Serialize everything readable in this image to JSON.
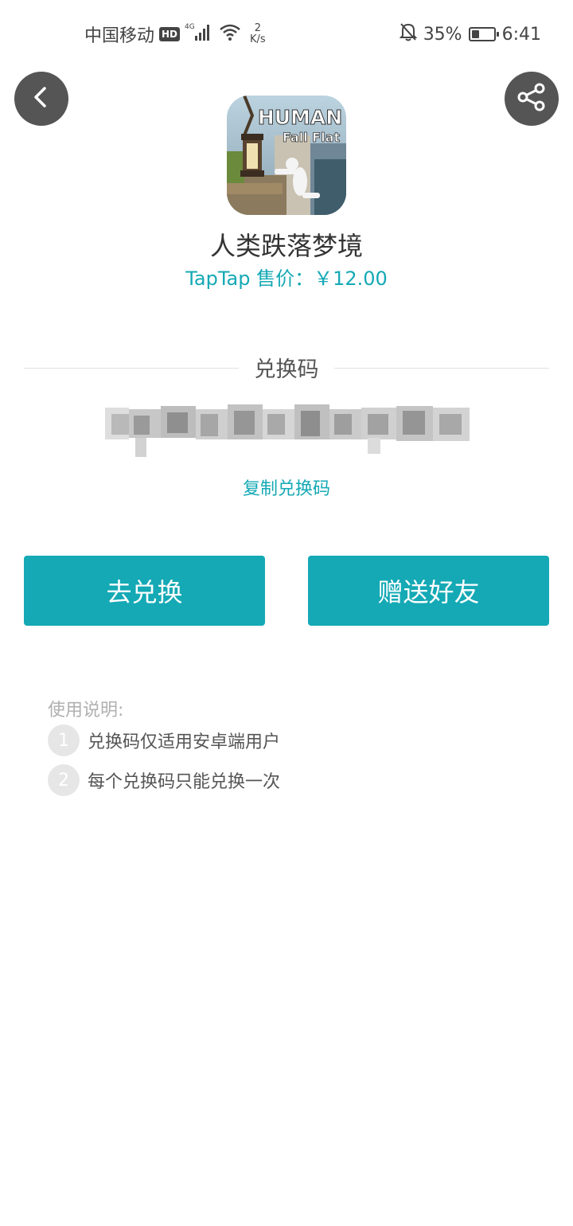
{
  "status_bar": {
    "carrier": "中国移动",
    "hd_badge": "HD",
    "network_type": "4G",
    "net_speed_value": "2",
    "net_speed_unit": "K/s",
    "battery_percent": "35%",
    "battery_level": 0.35,
    "time": "6:41"
  },
  "app": {
    "name": "人类跌落梦境",
    "price": "TapTap 售价：￥12.00",
    "icon_text_line1": "HUMAN",
    "icon_text_line2": "Fall Flat"
  },
  "code_section": {
    "label": "兑换码",
    "copy_label": "复制兑换码"
  },
  "buttons": {
    "redeem_label": "去兑换",
    "gift_label": "赠送好友"
  },
  "instructions": {
    "title": "使用说明:",
    "items": [
      {
        "num": "1",
        "text": "兑换码仅适用安卓端用户"
      },
      {
        "num": "2",
        "text": "每个兑换码只能兑换一次"
      }
    ]
  },
  "icons": {
    "back": "chevron-left-icon",
    "share": "share-icon"
  },
  "colors": {
    "accent": "#14a9b5",
    "circle_button": "#555555"
  }
}
